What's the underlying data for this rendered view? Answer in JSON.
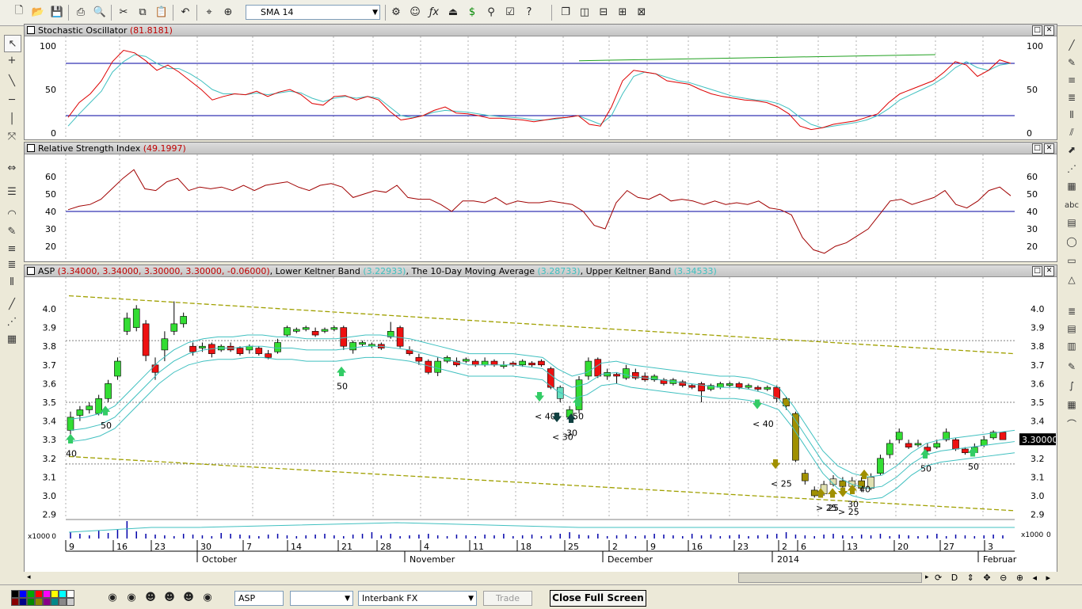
{
  "toolbar": {
    "indicator_select": "SMA 14",
    "icons": [
      "new-icon",
      "open-icon",
      "save-icon",
      "print-icon",
      "print-preview-icon",
      "cut-icon",
      "copy-icon",
      "paste-icon",
      "undo-icon",
      "crosshair-icon",
      "zoom-icon",
      "indicator-icon",
      "fx-icon",
      "expert-icon",
      "dollar-icon",
      "binoculars-icon",
      "checklist-icon",
      "help-icon",
      "window-cascade-icon",
      "tile-vertical-icon",
      "tile-horizontal-icon",
      "tile-grid-icon",
      "arrange-icon"
    ]
  },
  "stochastic": {
    "title": "Stochastic Oscillator",
    "value": "(81.8181)",
    "y_labels": [
      "100",
      "50",
      "0"
    ]
  },
  "rsi": {
    "title": "Relative Strength Index",
    "value": "(49.1997)",
    "y_labels": [
      "60",
      "50",
      "40",
      "30",
      "20"
    ]
  },
  "price": {
    "prefix": "ASP",
    "ohlc": "(3.34000, 3.34000, 3.30000, 3.30000, -0.06000)",
    "lower_kb": "Lower Keltner Band",
    "lower_kb_val": "(3.22933)",
    "ma": "The 10-Day Moving Average",
    "ma_val": "(3.28733)",
    "upper_kb": "Upper Keltner Band",
    "upper_kb_val": "(3.34533)",
    "y_labels": [
      "4.0",
      "3.9",
      "3.8",
      "3.7",
      "3.6",
      "3.5",
      "3.4",
      "3.3",
      "3.2",
      "3.1",
      "3.0",
      "2.9"
    ],
    "current_price": "3.30000",
    "annotations": [
      "40",
      "50",
      "50",
      "< 40",
      "< 30",
      "30",
      "50",
      "< 40",
      "< 25",
      "> 25",
      "25",
      "> 25",
      "30",
      "40",
      "50",
      "50"
    ]
  },
  "volume": {
    "label": "x1000",
    "zero": "0",
    "right_label": "x1000",
    "right_zero": "0"
  },
  "xaxis": {
    "days": [
      "9",
      "16",
      "23",
      "30",
      "7",
      "14",
      "21",
      "28",
      "4",
      "11",
      "18",
      "25",
      "2",
      "9",
      "16",
      "23",
      "2",
      "6",
      "13",
      "20",
      "27",
      "3"
    ],
    "months": [
      "October",
      "November",
      "December",
      "2014",
      "Februar"
    ]
  },
  "statusbar": {
    "symbol": "ASP",
    "period": "",
    "feed": "Interbank FX",
    "trade": "Trade",
    "close_fullscreen": "Close Full Screen"
  },
  "colors": {
    "up_candle": "#33dd33",
    "down_candle": "#ee1111",
    "keltner": "#40c0c0",
    "trendline": "#a0a000",
    "stoch_k": "#dd0000",
    "stoch_d": "#40c0c0",
    "level_line": "#0000a0"
  }
}
